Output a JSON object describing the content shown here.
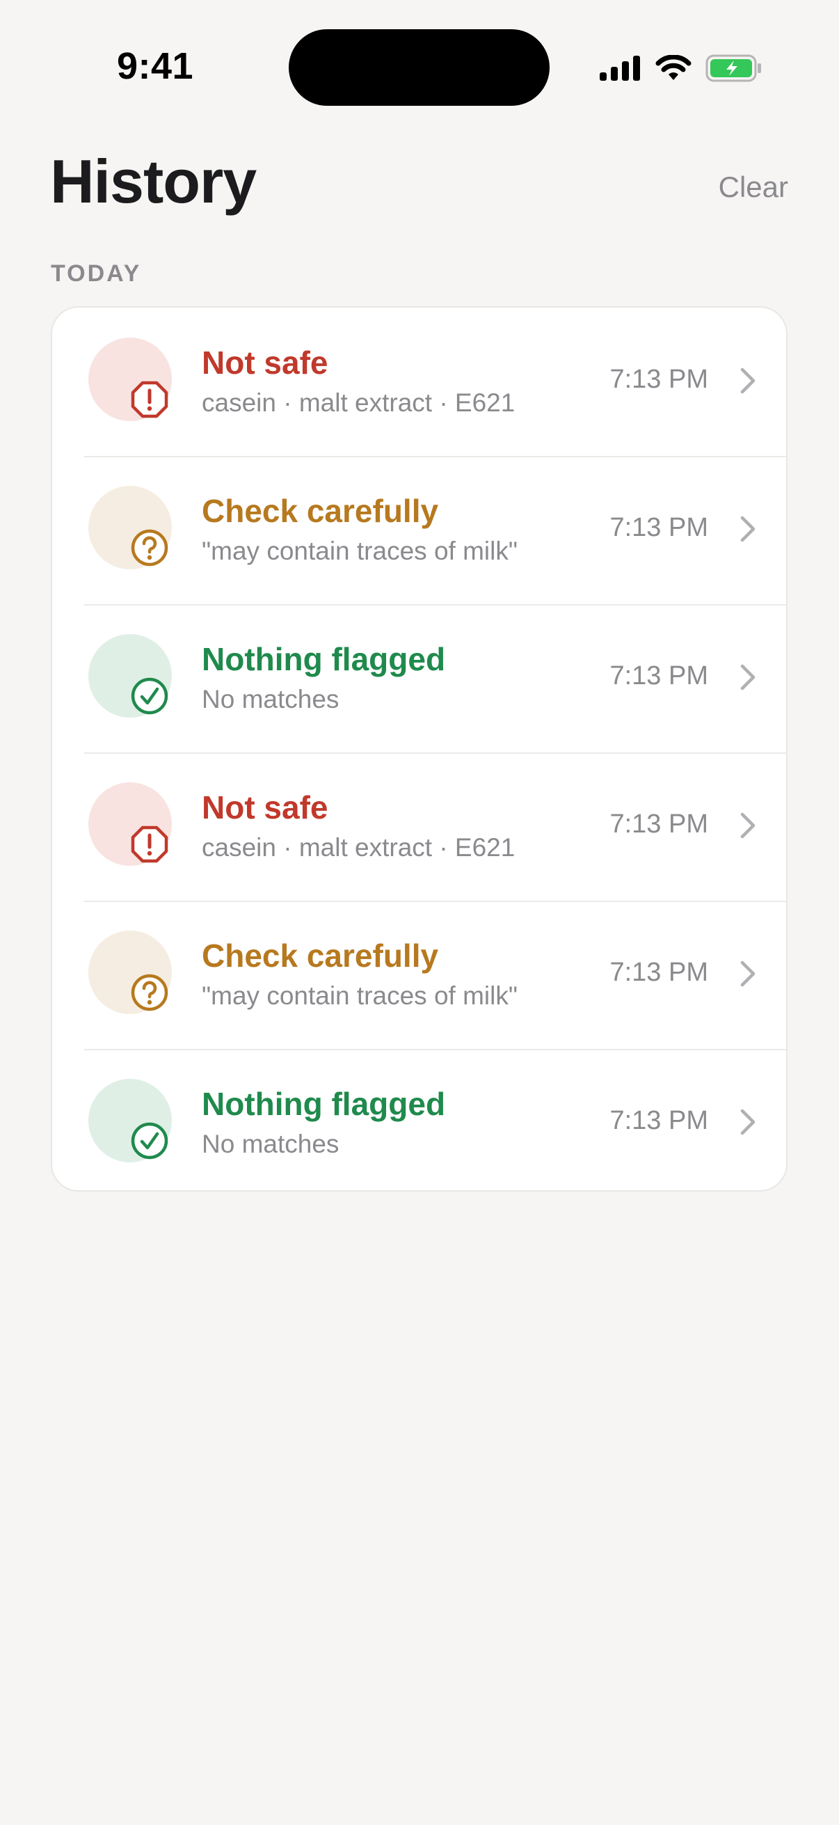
{
  "status_bar": {
    "time": "9:41",
    "icons": [
      "signal-icon",
      "wifi-icon",
      "battery-charging-icon"
    ],
    "battery_color": "#34c759"
  },
  "header": {
    "title": "History",
    "clear_label": "Clear"
  },
  "section": {
    "label": "TODAY"
  },
  "colors": {
    "unsafe": "#c0392b",
    "caution": "#b7791f",
    "safe": "#1f8a4c",
    "secondary_text": "#8a8a8e"
  },
  "rows": [
    {
      "status": "unsafe",
      "icon": "alert-octagon-icon",
      "title": "Not safe",
      "subtitle": "casein · malt extract · E621",
      "time": "7:13 PM"
    },
    {
      "status": "caution",
      "icon": "question-circle-icon",
      "title": "Check carefully",
      "subtitle": "\"may contain traces of milk\"",
      "time": "7:13 PM"
    },
    {
      "status": "safe",
      "icon": "check-circle-icon",
      "title": "Nothing flagged",
      "subtitle": "No matches",
      "time": "7:13 PM"
    },
    {
      "status": "unsafe",
      "icon": "alert-octagon-icon",
      "title": "Not safe",
      "subtitle": "casein · malt extract · E621",
      "time": "7:13 PM"
    },
    {
      "status": "caution",
      "icon": "question-circle-icon",
      "title": "Check carefully",
      "subtitle": "\"may contain traces of milk\"",
      "time": "7:13 PM"
    },
    {
      "status": "safe",
      "icon": "check-circle-icon",
      "title": "Nothing flagged",
      "subtitle": "No matches",
      "time": "7:13 PM"
    }
  ]
}
